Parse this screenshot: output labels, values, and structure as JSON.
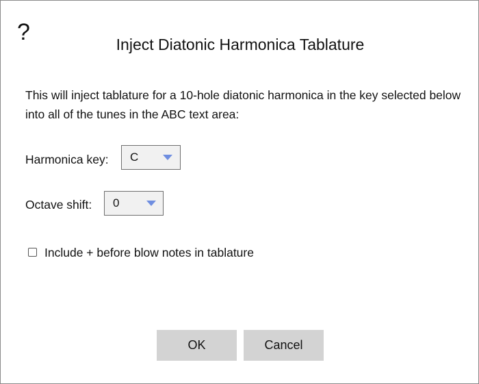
{
  "dialog": {
    "help_icon": "?",
    "title": "Inject Diatonic Harmonica Tablature",
    "description": "This will inject tablature for a 10-hole diatonic harmonica in the key selected below into all of the tunes in the ABC text area:"
  },
  "fields": {
    "harmonica_key": {
      "label": "Harmonica key:",
      "value": "C"
    },
    "octave_shift": {
      "label": "Octave shift:",
      "value": "0"
    }
  },
  "options": {
    "include_plus": {
      "label": "Include + before blow notes in tablature",
      "checked": false
    }
  },
  "buttons": {
    "ok": "OK",
    "cancel": "Cancel"
  },
  "colors": {
    "dropdown_arrow": "#6f8ee0",
    "button_bg": "#d3d3d3",
    "select_bg": "#f1f1f1"
  },
  "icons": {
    "help": "question-mark-icon",
    "dropdown": "chevron-down-icon"
  }
}
